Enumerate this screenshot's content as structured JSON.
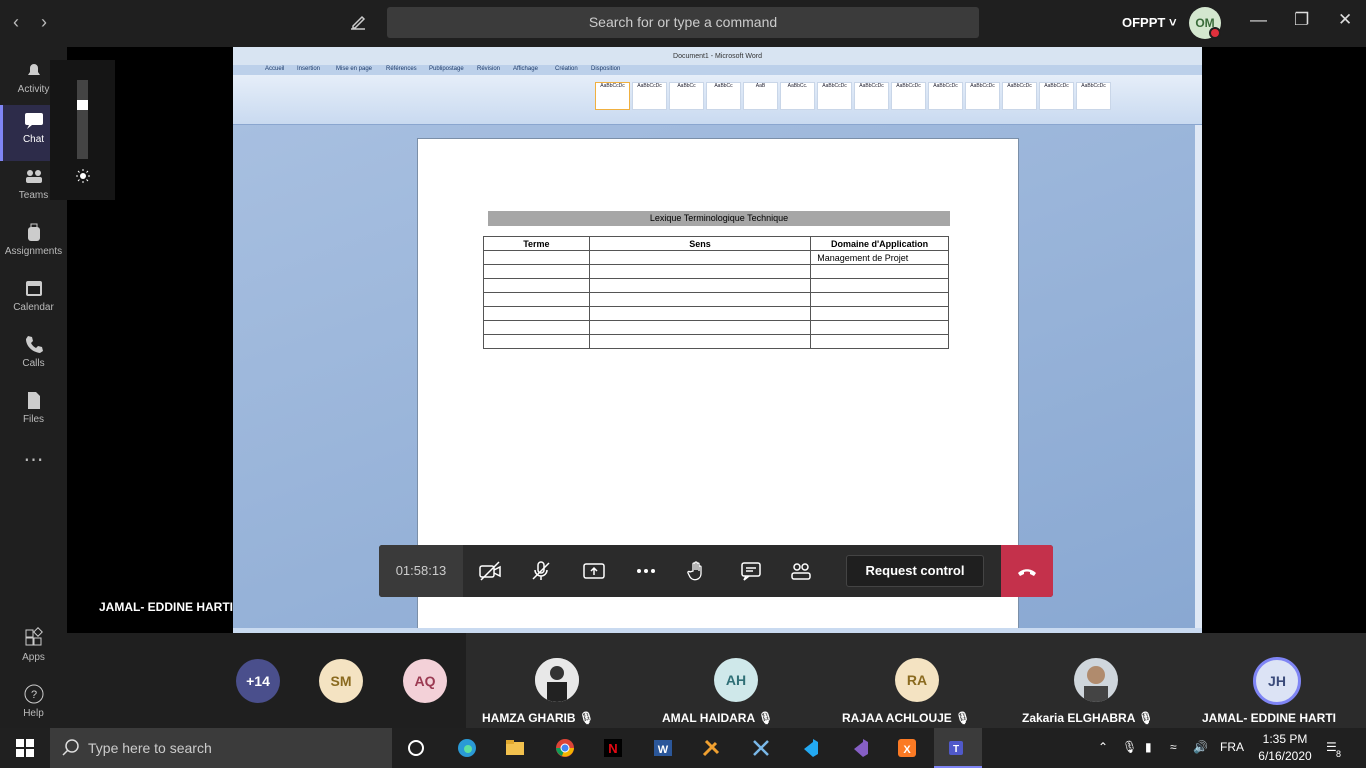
{
  "titlebar": {
    "search_placeholder": "Search for or type a command",
    "org": "OFPPT",
    "avatar": "OM"
  },
  "rail": [
    {
      "label": "Activity"
    },
    {
      "label": "Chat"
    },
    {
      "label": "Teams"
    },
    {
      "label": "Assignments"
    },
    {
      "label": "Calendar"
    },
    {
      "label": "Calls"
    },
    {
      "label": "Files"
    },
    {
      "label": "Apps"
    },
    {
      "label": "Help"
    }
  ],
  "word": {
    "title": "Document1 - Microsoft Word",
    "tabs": [
      "Accueil",
      "Insertion",
      "Mise en page",
      "Références",
      "Publipostage",
      "Révision",
      "Affichage",
      "Création",
      "Disposition"
    ],
    "styles": [
      "AaBbCcDc",
      "AaBbCcDc",
      "AaBbCc",
      "AaBbCc",
      "AaB",
      "AaBbCc.",
      "AaBbCcDc",
      "AaBbCcDc",
      "AaBbCcDc",
      "AaBbCcDc",
      "AaBbCcDc",
      "AaBbCcDc",
      "AaBbCcDc",
      "AaBbCcDc"
    ],
    "doc": {
      "title": "Lexique Terminologique Technique",
      "headers": [
        "Terme",
        "Sens",
        "Domaine d'Application"
      ],
      "row1_domain": "Management de Projet"
    }
  },
  "call": {
    "timer": "01:58:13",
    "request_label": "Request control",
    "presenter": "JAMAL- EDDINE HARTI"
  },
  "participants": [
    {
      "initials": "+14",
      "color": "#4a4f8c",
      "text": "#ffffff"
    },
    {
      "initials": "SM",
      "color": "#f4e3c2",
      "text": "#8a6a1f"
    },
    {
      "initials": "AQ",
      "color": "#f3d1d8",
      "text": "#9b3a52"
    },
    {
      "name": "HAMZA GHARIB"
    },
    {
      "initials": "AH",
      "name": "AMAL HAIDARA",
      "color": "#cfe8ea",
      "text": "#2f6f76"
    },
    {
      "initials": "RA",
      "name": "RAJAA ACHLOUJE",
      "color": "#f4e3c2",
      "text": "#8a6a1f"
    },
    {
      "name": "Zakaria ELGHABRA"
    },
    {
      "initials": "JH",
      "name": "JAMAL- EDDINE HARTI",
      "color": "#dce3f5",
      "text": "#3a4a7a"
    }
  ],
  "taskbar": {
    "search_placeholder": "Type here to search",
    "lang": "FRA",
    "time": "1:35 PM",
    "date": "6/16/2020",
    "notif": "8"
  }
}
